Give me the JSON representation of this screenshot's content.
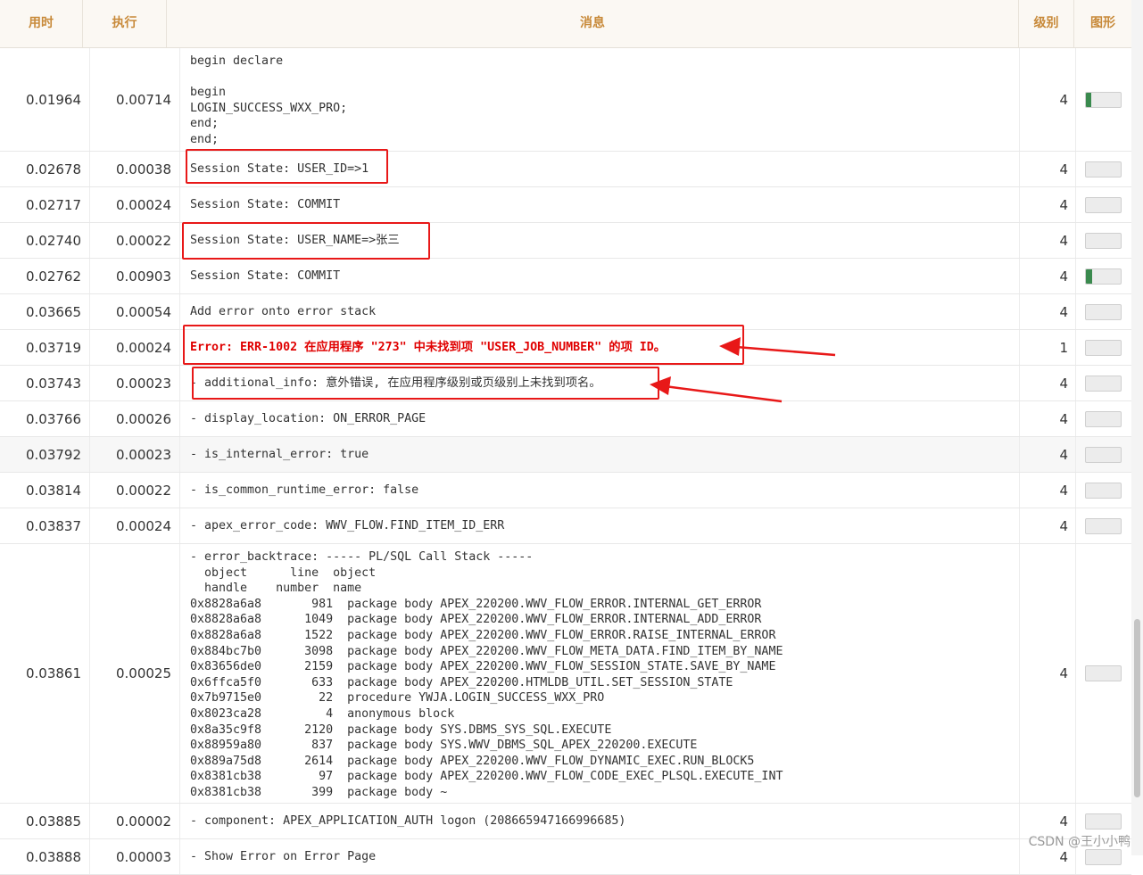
{
  "header": {
    "col_time": "用时",
    "col_exec": "执行",
    "col_msg": "消息",
    "col_level": "级别",
    "col_graph": "图形"
  },
  "rows": [
    {
      "time": "0.01964",
      "exec": "0.00714",
      "msg": "begin declare\n\nbegin\nLOGIN_SUCCESS_WXX_PRO;\nend;\nend;",
      "level": "4",
      "graph": 0.15
    },
    {
      "time": "0.02678",
      "exec": "0.00038",
      "msg": "Session State: USER_ID=>1",
      "level": "4",
      "graph": 0
    },
    {
      "time": "0.02717",
      "exec": "0.00024",
      "msg": "Session State: COMMIT",
      "level": "4",
      "graph": 0
    },
    {
      "time": "0.02740",
      "exec": "0.00022",
      "msg": "Session State: USER_NAME=>张三",
      "level": "4",
      "graph": 0
    },
    {
      "time": "0.02762",
      "exec": "0.00903",
      "msg": "Session State: COMMIT",
      "level": "4",
      "graph": 0.18
    },
    {
      "time": "0.03665",
      "exec": "0.00054",
      "msg": "Add error onto error stack",
      "level": "4",
      "graph": 0
    },
    {
      "time": "0.03719",
      "exec": "0.00024",
      "msg": "Error: ERR-1002 在应用程序 \"273\" 中未找到项 \"USER_JOB_NUMBER\" 的项 ID。",
      "level": "1",
      "graph": 0
    },
    {
      "time": "0.03743",
      "exec": "0.00023",
      "msg": "- additional_info: 意外错误, 在应用程序级别或页级别上未找到项名。",
      "level": "4",
      "graph": 0
    },
    {
      "time": "0.03766",
      "exec": "0.00026",
      "msg": "- display_location: ON_ERROR_PAGE",
      "level": "4",
      "graph": 0
    },
    {
      "time": "0.03792",
      "exec": "0.00023",
      "msg": "- is_internal_error: true",
      "level": "4",
      "graph": 0
    },
    {
      "time": "0.03814",
      "exec": "0.00022",
      "msg": "- is_common_runtime_error: false",
      "level": "4",
      "graph": 0
    },
    {
      "time": "0.03837",
      "exec": "0.00024",
      "msg": "- apex_error_code: WWV_FLOW.FIND_ITEM_ID_ERR",
      "level": "4",
      "graph": 0
    },
    {
      "time": "0.03861",
      "exec": "0.00025",
      "msg": "- error_backtrace: ----- PL/SQL Call Stack -----\n  object      line  object\n  handle    number  name\n0x8828a6a8       981  package body APEX_220200.WWV_FLOW_ERROR.INTERNAL_GET_ERROR\n0x8828a6a8      1049  package body APEX_220200.WWV_FLOW_ERROR.INTERNAL_ADD_ERROR\n0x8828a6a8      1522  package body APEX_220200.WWV_FLOW_ERROR.RAISE_INTERNAL_ERROR\n0x884bc7b0      3098  package body APEX_220200.WWV_FLOW_META_DATA.FIND_ITEM_BY_NAME\n0x83656de0      2159  package body APEX_220200.WWV_FLOW_SESSION_STATE.SAVE_BY_NAME\n0x6ffca5f0       633  package body APEX_220200.HTMLDB_UTIL.SET_SESSION_STATE\n0x7b9715e0        22  procedure YWJA.LOGIN_SUCCESS_WXX_PRO\n0x8023ca28         4  anonymous block\n0x8a35c9f8      2120  package body SYS.DBMS_SYS_SQL.EXECUTE\n0x88959a80       837  package body SYS.WWV_DBMS_SQL_APEX_220200.EXECUTE\n0x889a75d8      2614  package body APEX_220200.WWV_FLOW_DYNAMIC_EXEC.RUN_BLOCK5\n0x8381cb38        97  package body APEX_220200.WWV_FLOW_CODE_EXEC_PLSQL.EXECUTE_INT\n0x8381cb38       399  package body ~",
      "level": "4",
      "graph": 0
    },
    {
      "time": "0.03885",
      "exec": "0.00002",
      "msg": "- component: APEX_APPLICATION_AUTH logon (208665947166996685)",
      "level": "4",
      "graph": 0
    },
    {
      "time": "0.03888",
      "exec": "0.00003",
      "msg": "- Show Error on Error Page",
      "level": "4",
      "graph": 0
    }
  ],
  "watermark": "CSDN @王小小鸭",
  "colors": {
    "header_text": "#c88a3a",
    "error_text": "#e00000",
    "annotation": "#e81818",
    "bar_fill": "#3a8a4e"
  }
}
